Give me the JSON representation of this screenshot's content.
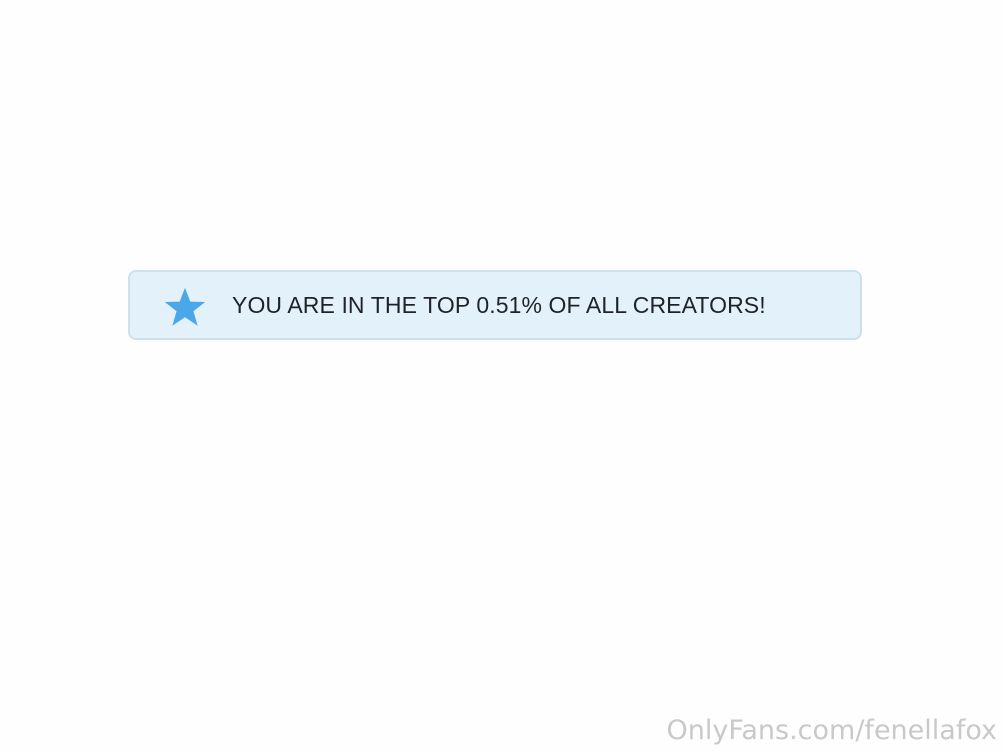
{
  "notice": {
    "icon": "star-icon",
    "icon_color": "#4aa8e8",
    "background_color": "#e3f2fa",
    "text": "YOU ARE IN THE TOP 0.51% OF ALL CREATORS!"
  },
  "watermark": {
    "text": "OnlyFans.com/fenellafox"
  }
}
